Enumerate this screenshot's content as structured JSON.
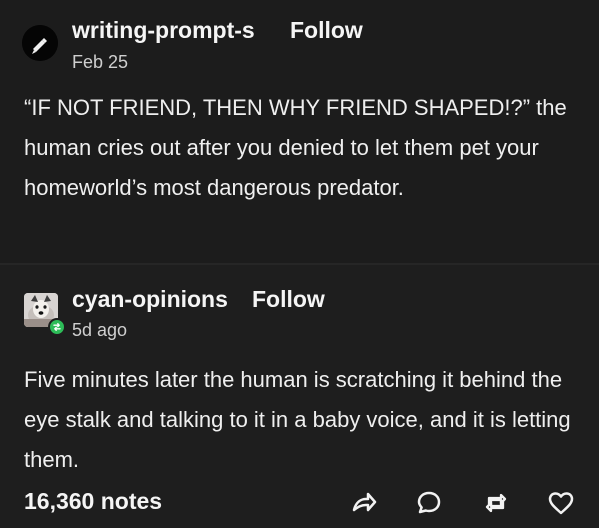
{
  "post": {
    "primary": {
      "username": "writing-prompt-s",
      "follow": "Follow",
      "date": "Feb 25",
      "text": "“IF NOT FRIEND, THEN WHY FRIEND SHAPED!?” the human cries out after you denied to let them pet your homeworld’s most dangerous predator.",
      "avatar_icon": "pen-nib-icon"
    },
    "reply": {
      "username": "cyan-opinions",
      "follow": "Follow",
      "date": "5d ago",
      "text": "Five minutes later the human is scratching it behind the eye stalk and talking to it in a baby voice, and it is letting them.",
      "avatar_icon": "opossum-avatar",
      "badge_icon": "reblog-icon"
    },
    "footer": {
      "notes": "16,360 notes",
      "actions": [
        "share-icon",
        "reply-icon",
        "reblog-icon",
        "like-icon"
      ]
    }
  },
  "colors": {
    "background": "#1c1c1c",
    "text": "#f2f2f2",
    "secondary_text": "#cfcfcf",
    "badge_green": "#2dbc58",
    "divider": "#262626"
  }
}
